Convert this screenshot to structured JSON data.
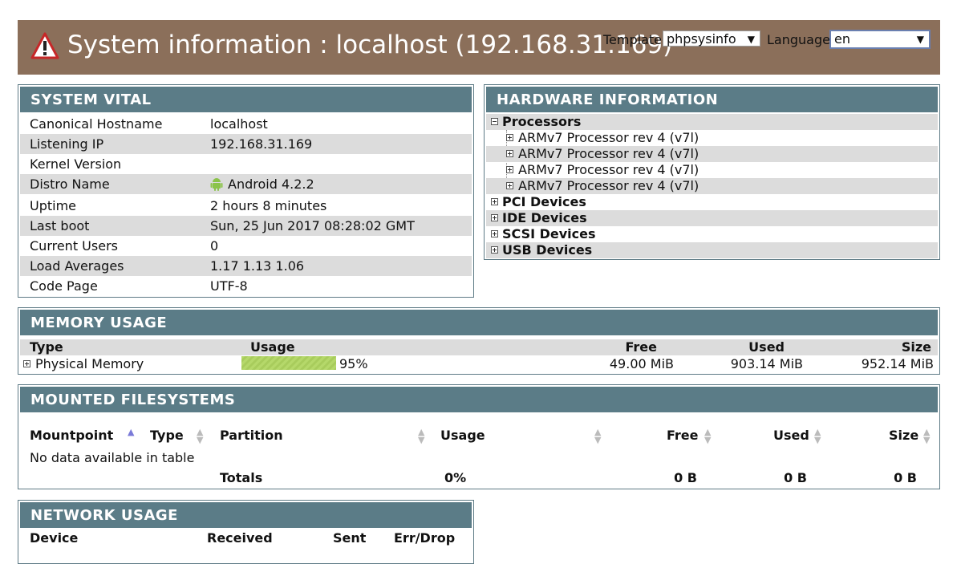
{
  "header": {
    "title": "System information : localhost (192.168.31.169)",
    "template_label": "Template",
    "template_value": "phpsysinfo",
    "language_label": "Language",
    "language_value": "en"
  },
  "vital": {
    "title": "SYSTEM VITAL",
    "rows": [
      {
        "key": "Canonical Hostname",
        "value": "localhost"
      },
      {
        "key": "Listening IP",
        "value": "192.168.31.169"
      },
      {
        "key": "Kernel Version",
        "value": ""
      },
      {
        "key": "Distro Name",
        "value": "Android 4.2.2"
      },
      {
        "key": "Uptime",
        "value": "2 hours 8 minutes"
      },
      {
        "key": "Last boot",
        "value": "Sun, 25 Jun 2017 08:28:02 GMT"
      },
      {
        "key": "Current Users",
        "value": "0"
      },
      {
        "key": "Load Averages",
        "value": "1.17 1.13 1.06"
      },
      {
        "key": "Code Page",
        "value": "UTF-8"
      }
    ]
  },
  "hardware": {
    "title": "HARDWARE INFORMATION",
    "processors_label": "Processors",
    "processors": [
      "ARMv7 Processor rev 4 (v7l)",
      "ARMv7 Processor rev 4 (v7l)",
      "ARMv7 Processor rev 4 (v7l)",
      "ARMv7 Processor rev 4 (v7l)"
    ],
    "groups": [
      "PCI Devices",
      "IDE Devices",
      "SCSI Devices",
      "USB Devices"
    ]
  },
  "memory": {
    "title": "MEMORY USAGE",
    "columns": {
      "type": "Type",
      "usage": "Usage",
      "free": "Free",
      "used": "Used",
      "size": "Size"
    },
    "row": {
      "type": "Physical Memory",
      "usage": "95%",
      "free": "49.00 MiB",
      "used": "903.14 MiB",
      "size": "952.14 MiB"
    }
  },
  "filesystems": {
    "title": "MOUNTED FILESYSTEMS",
    "columns": {
      "mountpoint": "Mountpoint",
      "type": "Type",
      "partition": "Partition",
      "usage": "Usage",
      "free": "Free",
      "used": "Used",
      "size": "Size"
    },
    "empty": "No data available in table",
    "totals": {
      "label": "Totals",
      "usage": "0%",
      "free": "0 B",
      "used": "0 B",
      "size": "0 B"
    }
  },
  "network": {
    "title": "NETWORK USAGE",
    "columns": {
      "device": "Device",
      "received": "Received",
      "sent": "Sent",
      "errdrop": "Err/Drop"
    }
  },
  "colors": {
    "header_bg": "#8b6f5a",
    "panel_title_bg": "#5b7c87",
    "usage_bar": "#b5d86a",
    "alt_row": "#dcdcdc"
  }
}
